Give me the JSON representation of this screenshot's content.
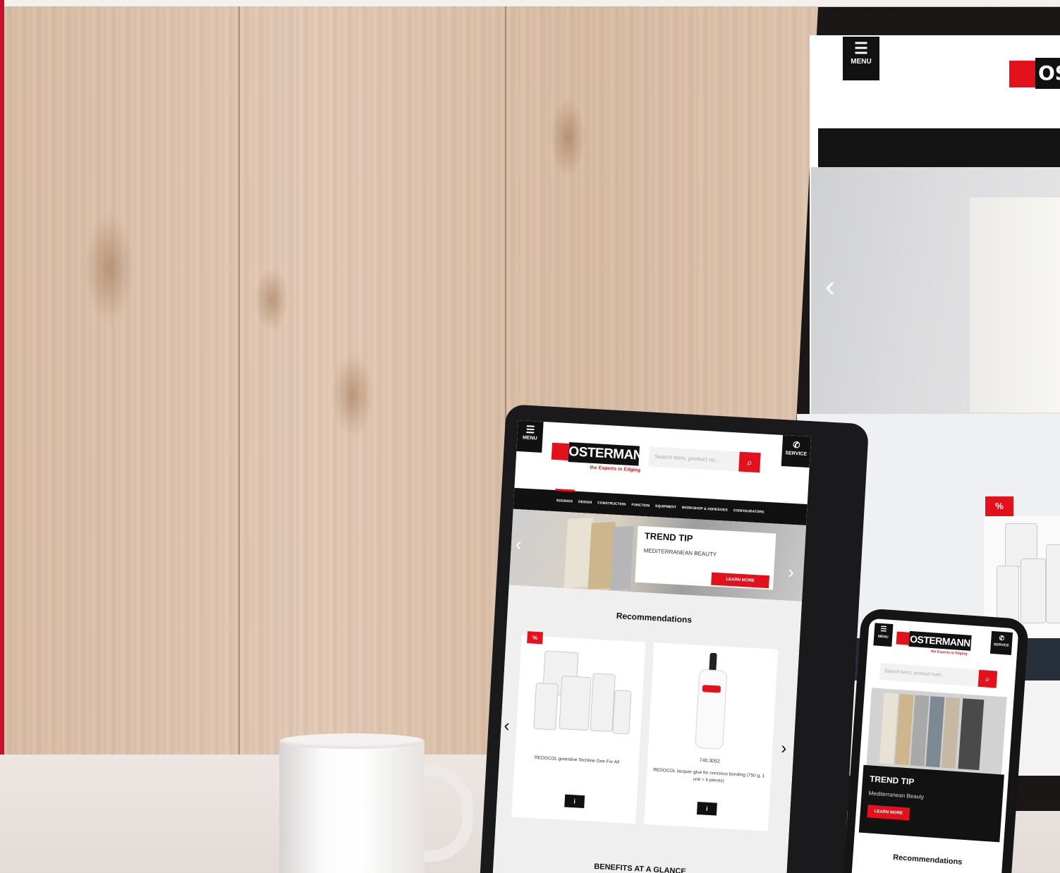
{
  "desktop": {
    "menu_label": "MENU",
    "menu_icon": "hamburger-icon",
    "logo_text": "OS",
    "badge": "%",
    "arrow_left": "‹"
  },
  "tablet": {
    "menu_label": "MENU",
    "service_label": "SERVICE",
    "logo_text": "OSTERMANN",
    "tagline": "the Experts in Edging",
    "search_placeholder": "Search term, product no...",
    "nav_items": [
      "EDGINGS",
      "DESIGN",
      "CONSTRUCTION",
      "FUNCTION",
      "EQUIPMENT",
      "WORKSHOP & ADHESIVES",
      "CONFIGURATORS"
    ],
    "hero": {
      "title": "TREND TIP",
      "subtitle": "MEDITERRANEAN BEAUTY",
      "button": "LEARN MORE"
    },
    "recommendations_title": "Recommendations",
    "badge": "%",
    "products": [
      {
        "number": "",
        "name": "REDOCOL greenline Techline One For All",
        "button": "i"
      },
      {
        "number": "740.3052",
        "name": "REDOCOL lacquer glue for concious bonding (750 g, 1 unit = 6 pieces)",
        "button": "i"
      }
    ],
    "benefits_title": "BENEFITS AT A GLANCE"
  },
  "phone": {
    "menu_label": "MENU",
    "service_label": "SERVICE",
    "logo_text": "OSTERMANN",
    "tagline": "the Experts in Edging",
    "search_placeholder": "Search term, product num...",
    "hero": {
      "title": "TREND TIP",
      "subtitle": "Mediterranean Beauty",
      "button": "LEARN MORE"
    },
    "recommendations_title": "Recommendations"
  },
  "colors": {
    "brand_red": "#e3111b",
    "dark": "#111111"
  }
}
